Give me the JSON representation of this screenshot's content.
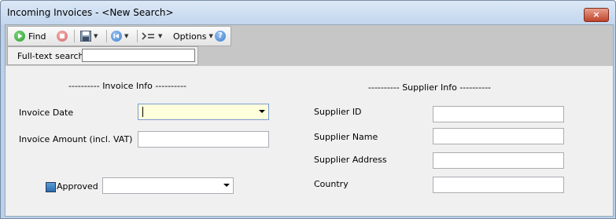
{
  "window": {
    "title": "Incoming Invoices - <New Search>",
    "close_label": "×"
  },
  "toolbar": {
    "find_label": "Find",
    "options_label": "Options",
    "icons": [
      "find-play-icon",
      "stop-icon",
      "save-icon",
      "navigate-first-icon",
      "filter-icon",
      "help-icon"
    ],
    "colors": {
      "find": "#2e9e2e",
      "stop": "#e07070",
      "nav": "#3b7fd0",
      "help": "#3b7fd0"
    }
  },
  "fulltext": {
    "label": "Full-text search:",
    "value": ""
  },
  "invoice_section": {
    "header": "---------- Invoice Info ----------",
    "date_label": "Invoice Date",
    "date_value": "",
    "amount_label": "Invoice Amount (incl. VAT)",
    "amount_value": "",
    "approved_label": "Approved",
    "approved_value": ""
  },
  "supplier_section": {
    "header": "---------- Supplier Info ----------",
    "id_label": "Supplier ID",
    "name_label": "Supplier Name",
    "address_label": "Supplier Address",
    "country_label": "Country",
    "id_value": "",
    "name_value": "",
    "address_value": "",
    "country_value": ""
  }
}
